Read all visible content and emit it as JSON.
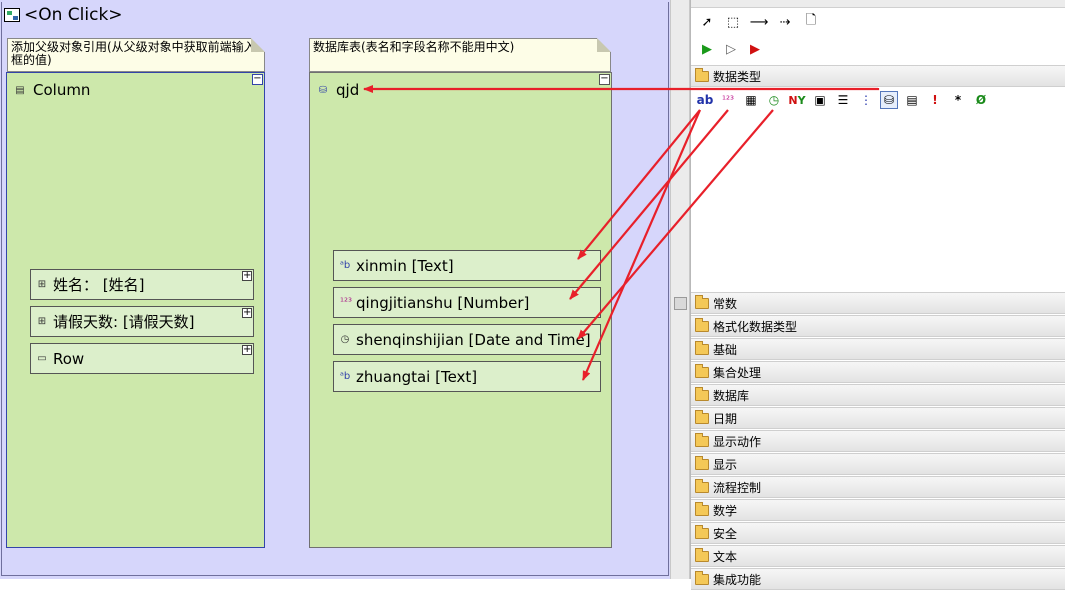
{
  "canvas": {
    "title": "<On Click>",
    "left_note": "添加父级对象引用(从父级对象中获取前端输入框的值)",
    "right_note": "数据库表(表名和字段名称不能用中文)",
    "left_panel": {
      "header": "Column",
      "fields": [
        {
          "label": "姓名：  [姓名]"
        },
        {
          "label": "请假天数: [请假天数]"
        },
        {
          "label": "Row"
        }
      ]
    },
    "right_panel": {
      "header": "qjd",
      "fields": [
        {
          "label": "xinmin [Text]",
          "icon": "text-type-icon"
        },
        {
          "label": "qingjitianshu [Number]",
          "icon": "number-type-icon"
        },
        {
          "label": "shenqinshijian [Date and Time]",
          "icon": "clock-icon"
        },
        {
          "label": "zhuangtai [Text]",
          "icon": "text-type-icon"
        }
      ]
    }
  },
  "palette": {
    "datatype_section": "数据类型",
    "datatype_icons": [
      "text-type-icon",
      "number-type-icon",
      "memo-type-icon",
      "datetime-type-icon",
      "yes-no-type-icon",
      "binary-type-icon",
      "list-type-icon",
      "tree-type-icon",
      "table-type-icon",
      "document-type-icon",
      "exclamation-icon",
      "asterisk-icon",
      "null-icon"
    ],
    "categories": [
      "常数",
      "格式化数据类型",
      "基础",
      "集合处理",
      "数据库",
      "日期",
      "显示动作",
      "显示",
      "流程控制",
      "数学",
      "安全",
      "文本",
      "集成功能"
    ]
  },
  "colors": {
    "canvas_bg": "#d6d6fb",
    "panel_bg": "#cde8ab",
    "field_bg": "#dcefcb",
    "arrow": "#e8202a"
  }
}
